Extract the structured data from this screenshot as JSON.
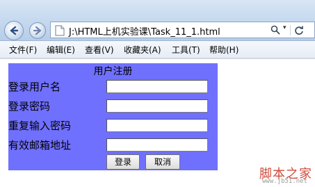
{
  "browser": {
    "address": "J:\\HTML上机实验课\\Task_11_1.html"
  },
  "menu": [
    {
      "label": "文件(F)"
    },
    {
      "label": "编辑(E)"
    },
    {
      "label": "查看(V)"
    },
    {
      "label": "收藏夹(A)"
    },
    {
      "label": "工具(T)"
    },
    {
      "label": "帮助(H)"
    }
  ],
  "form": {
    "title": "用户注册",
    "fields": [
      {
        "label": "登录用户名",
        "value": ""
      },
      {
        "label": "登录密码",
        "value": ""
      },
      {
        "label": "重复输入密码",
        "value": ""
      },
      {
        "label": "有效邮箱地址",
        "value": ""
      }
    ],
    "submit_label": "登录",
    "cancel_label": "取消",
    "background": "#7070ff"
  },
  "watermark": {
    "main": "脚本之家",
    "sub": "www.jb51.net"
  }
}
